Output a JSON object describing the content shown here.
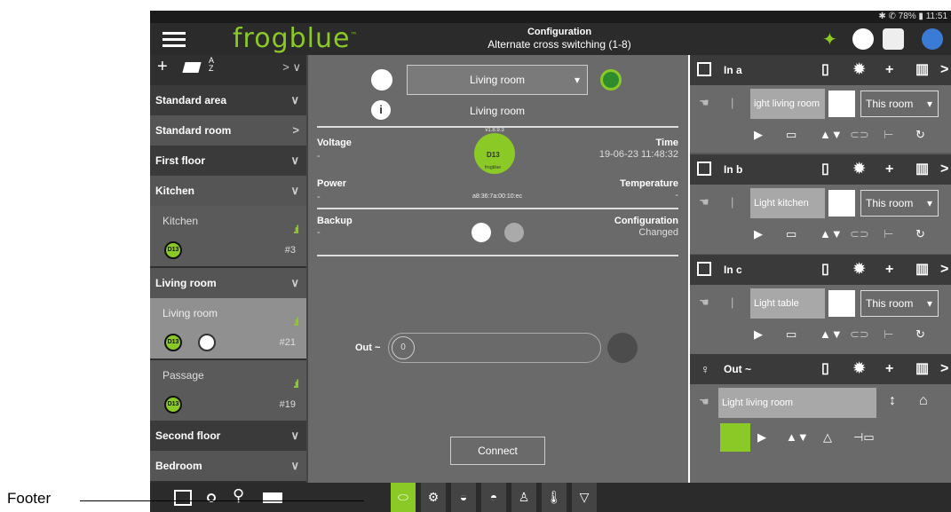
{
  "status": {
    "text": "✱ ✆ 78% ▮ 11:51"
  },
  "header": {
    "logo": "frogblue",
    "logo_tm": "™",
    "title": "Configuration",
    "subtitle": "Alternate cross switching (1-8)"
  },
  "left_panel": {
    "toolbar": {
      "add": "+",
      "sort_a": "A",
      "sort_z": "Z",
      "arrows": "> ∨"
    },
    "rows": [
      {
        "label": "Standard area",
        "kind": "section"
      },
      {
        "label": "Standard room",
        "kind": "subsection"
      },
      {
        "label": "First floor",
        "kind": "section"
      },
      {
        "label": "Kitchen",
        "kind": "subsection"
      },
      {
        "label": "Kitchen",
        "kind": "room",
        "number": "#3"
      },
      {
        "label": "Living room",
        "kind": "subsection"
      },
      {
        "label": "Living room",
        "kind": "room-selected",
        "number": "#21"
      },
      {
        "label": "Passage",
        "kind": "room",
        "number": "#19"
      },
      {
        "label": "Second floor",
        "kind": "section"
      },
      {
        "label": "Bedroom",
        "kind": "subsection"
      }
    ],
    "device_badge": "D13"
  },
  "middle": {
    "room_select": "Living room",
    "room_name": "Living room",
    "voltage_label": "Voltage",
    "voltage_value": "-",
    "time_label": "Time",
    "time_value": "19-06-23 11:48:32",
    "power_label": "Power",
    "power_value": "-",
    "temperature_label": "Temperature",
    "temperature_value": "-",
    "backup_label": "Backup",
    "backup_value": "-",
    "configuration_label": "Configuration",
    "configuration_value": "Changed",
    "device_version": "v1.8.9.3",
    "device_model": "D13",
    "device_brand": "frogblue",
    "device_mac": "a8:36:7a:00:10:ec",
    "out_label": "Out ~",
    "out_value": "0",
    "connect_label": "Connect"
  },
  "right_panel": {
    "sections": [
      {
        "title": "In a",
        "light": "ight living room",
        "room": "This room"
      },
      {
        "title": "In b",
        "light": "Light kitchen",
        "room": "This room"
      },
      {
        "title": "In c",
        "light": "Light table",
        "room": "This room"
      },
      {
        "title": "Out ~",
        "light": "Light living room"
      }
    ]
  },
  "annotation": {
    "label": "Footer"
  },
  "colors": {
    "accent": "#8ac926",
    "panel": "#2f2f2f",
    "middle": "#6a6a6a"
  }
}
